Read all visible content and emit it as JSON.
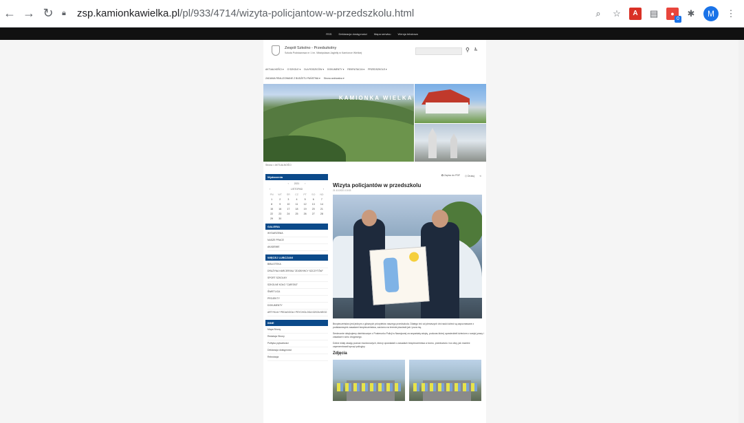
{
  "browser": {
    "url_host": "zsp.kamionkawielka.pl",
    "url_path": "/pl/933/4714/wizyta-policjantow-w-przedszkolu.html",
    "avatar_letter": "M",
    "extension_badge": "0"
  },
  "header": {
    "school_name": "Zespół Szkolno - Przedszkolny",
    "school_sub": "Szkoła Podstawowa nr 1 im. Władysława Jagiełły w Kamionce Wielkiej"
  },
  "banner": {
    "title": "KAMIONKA WIELKA"
  },
  "menu": {
    "row1": [
      "AKTUALNOŚCI ▾",
      "O SZKOLE ▾",
      "DLA RODZICÓW ▾",
      "DOKUMENTY ▾",
      "REKRUTACJA ▾",
      "PRZEDSZKOLE ▾"
    ],
    "row2": [
      "ZADANIA REALIZOWANE Z BUDŻETU PAŃSTWA ▾",
      "Strona archiwalna ▾"
    ]
  },
  "breadcrumb": "Strona > AKTUALNOŚCI",
  "sidebar": {
    "events_title": "Wydarzenia",
    "calendar": {
      "year": "2021",
      "month": "LISTOPAD",
      "weekdays": [
        "PN",
        "WT",
        "ŚR",
        "CZ",
        "PT",
        "SO",
        "ND"
      ],
      "days": [
        "1",
        "2",
        "3",
        "4",
        "5",
        "6",
        "7",
        "8",
        "9",
        "10",
        "11",
        "12",
        "13",
        "14",
        "15",
        "16",
        "17",
        "18",
        "19",
        "20",
        "21",
        "22",
        "23",
        "24",
        "25",
        "26",
        "27",
        "28",
        "29",
        "30"
      ]
    },
    "gallery_title": "GALERIA",
    "gallery_items": [
      "WYDARZENIA",
      "NASZE PRACE",
      "AKADEMIE"
    ],
    "more_title": "WIĘCEJ LUBCZANI",
    "more_items": [
      "BIBLIOTEKA",
      "DRUŻYNA HARCERSKA \"ZDOBYWCY SZCZYTÓW\"",
      "SPORT SZKOLNY",
      "SZKOLNE KOŁO \"CARITAS\"",
      "ŚWIETLICA",
      "PROJEKTY",
      "DOKUMENTY",
      "ARTYKUŁY PEDAGOGA I PSYCHOLOGA SZKOLNEGO"
    ],
    "other_title": "INNE",
    "other_items": [
      "Mapa Strony",
      "Redakcja Strony",
      "Polityka prywatności",
      "Deklaracja dostępności",
      "Rekrutacja"
    ]
  },
  "article": {
    "tool_pdf": "Zapisz do PDF",
    "tool_print": "Drukuj",
    "title": "Wizyta policjantów w przedszkolu",
    "date": "21.10.2021 13:03",
    "paragraph1": "Bezpieczeństwo jest jednym z głównych priorytetów naszego przedszkola. Dlatego też od pierwszych dni nauki dzieci są zapoznawane z podstawowymi zasadami bezpieczeństwa, zarówno na terenie placówki jak i poza nią.",
    "paragraph2": "Serdecznie dziękujemy dzielnicowym z Posterunku Policji w Nawojowej za wspaniałą wizytę, podczas której opowiedzieli dzieciom o swojej pracy i zasadach ruchu drogowego.",
    "paragraph3": "Dzieci miały okazję poznać mundurowych, którzy opowiadali o zasadach bezpieczeństwa w domu, przedszkolu i na ulicy, jak również zaprezentowali sprzęt policyjny.",
    "gallery_heading": "Zdjęcia"
  }
}
